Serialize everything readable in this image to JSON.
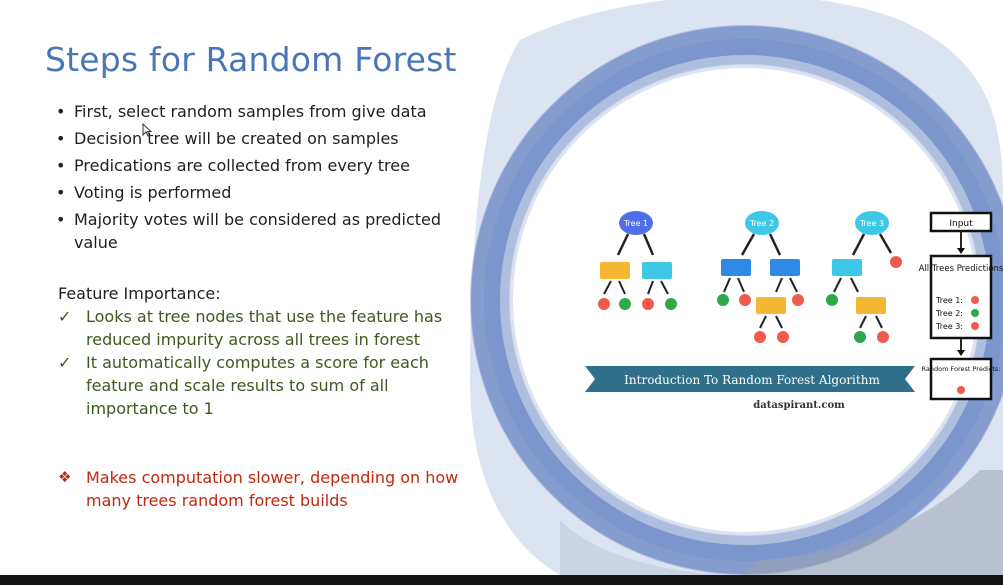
{
  "slide": {
    "title": "Steps for Random Forest",
    "bullets": [
      "First, select random samples from give data",
      "Decision tree will be created on samples",
      "Predications are collected from every tree",
      "Voting is performed",
      "Majority votes will be considered as predicted value"
    ],
    "feature_importance": {
      "heading": "Feature Importance:",
      "items": [
        "Looks at tree nodes that use the feature has reduced impurity across all trees in forest",
        "It automatically computes a score for each feature and scale results to sum of all importance to 1"
      ]
    },
    "note": "Makes computation slower, depending on how many trees random forest builds"
  },
  "figure": {
    "trees": [
      "Tree 1",
      "Tree 2",
      "Tree 3"
    ],
    "input_label": "Input",
    "predictions_title": "All Trees Predictions",
    "prediction_rows": [
      "Tree 1:",
      "Tree 2:",
      "Tree 3:"
    ],
    "final_label": "Random Forest Predicts:",
    "banner": "Introduction To Random Forest Algorithm",
    "credit": "dataspirant.com"
  },
  "icons": {
    "bullet": "bullet-dot-icon",
    "check": "checkmark-icon",
    "diamond": "four-diamond-icon",
    "cursor": "mouse-cursor-icon"
  },
  "colors": {
    "title": "#4a76b8",
    "check_text": "#3d5a1e",
    "note_text": "#c0280f",
    "brush_blue": "#5a7cc0",
    "banner": "#2f6f8a",
    "red_leaf": "#ef5b4c",
    "green_leaf": "#2da84a",
    "node_orange": "#f7b733",
    "node_cyan": "#3cc8e6",
    "node_blue": "#2e88e6"
  }
}
